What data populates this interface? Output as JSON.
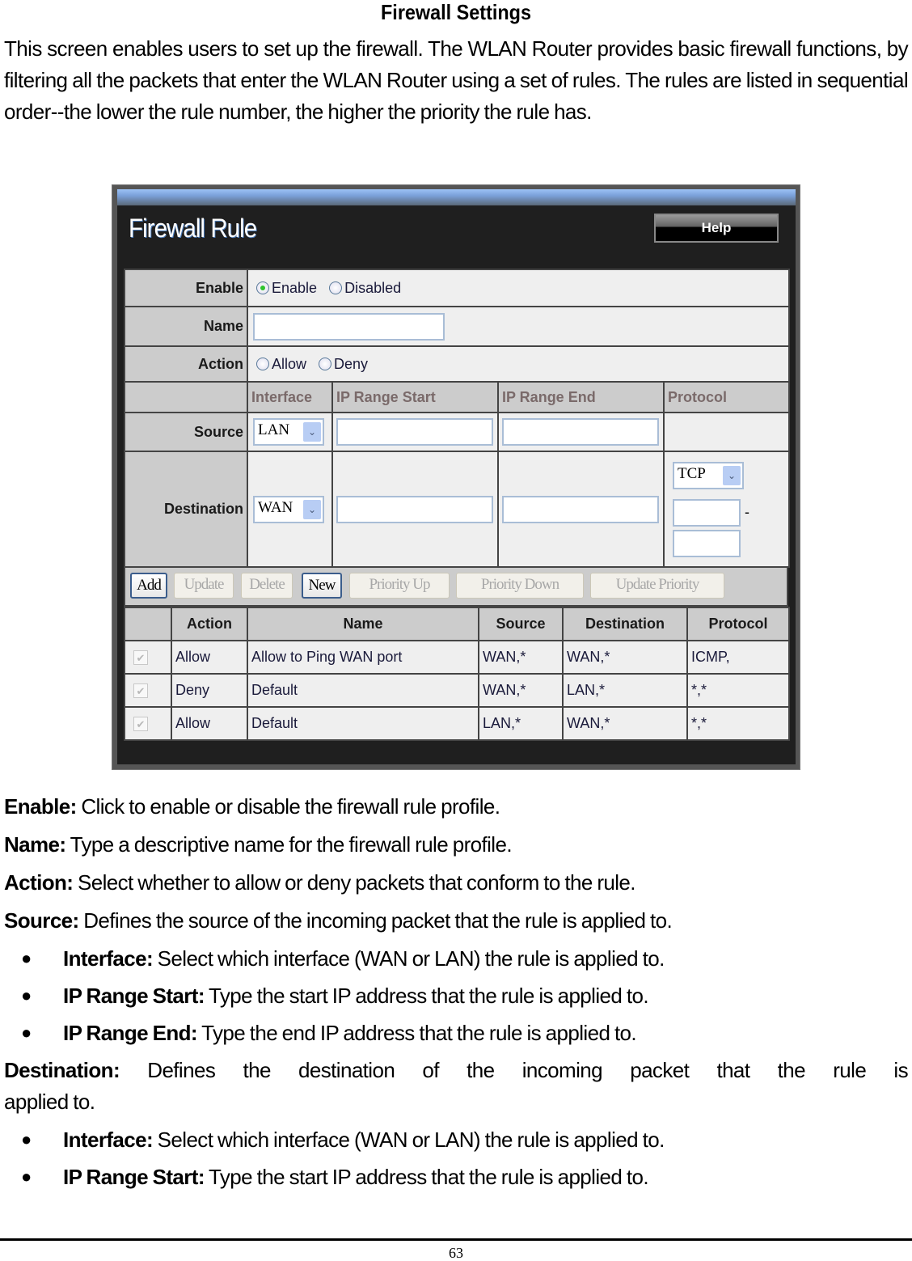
{
  "document": {
    "title": "Firewall Settings",
    "intro": "This screen enables users to set up the firewall. The WLAN Router provides basic firewall functions, by filtering all the packets that enter the WLAN Router using a set of rules. The rules are listed in sequential order--the lower the rule number, the higher the priority the rule has.",
    "descriptions": [
      {
        "term": "Enable:",
        "text": " Click to enable or disable the firewall rule profile."
      },
      {
        "term": "Name:",
        "text": " Type a descriptive name for the firewall rule profile."
      },
      {
        "term": "Action:",
        "text": " Select whether to allow or deny packets that conform to the rule."
      },
      {
        "term": "Source:",
        "text": " Defines the source of the incoming packet that the rule is applied to."
      }
    ],
    "source_bullets": [
      {
        "term": "Interface:",
        "text": " Select which interface (WAN or LAN) the rule is applied to."
      },
      {
        "term": "IP Range Start:",
        "text": " Type the start IP address that the rule is applied to."
      },
      {
        "term": "IP Range End:",
        "text": " Type the end IP address that the rule is applied to."
      }
    ],
    "destination": {
      "term": "Destination:",
      "text_line1": " Defines the destination of the incoming packet that the rule is",
      "text_line2": "applied to."
    },
    "destination_bullets": [
      {
        "term": "Interface:",
        "text": " Select which interface (WAN or LAN) the rule is applied to."
      },
      {
        "term": "IP Range Start:",
        "text": " Type the start IP address that the rule is applied to."
      }
    ],
    "bullet_glyph": "●",
    "page_number": "63"
  },
  "panel": {
    "title": "Firewall Rule",
    "help_label": "Help",
    "form": {
      "enable_label": "Enable",
      "enable_options": [
        "Enable",
        "Disabled"
      ],
      "enable_selected": "Enable",
      "name_label": "Name",
      "name_value": "",
      "action_label": "Action",
      "action_options": [
        "Allow",
        "Deny"
      ],
      "action_selected": "",
      "subheaders": [
        "Interface",
        "IP Range Start",
        "IP Range End",
        "Protocol"
      ],
      "source_label": "Source",
      "source_interface": "LAN",
      "source_ip_start": "",
      "source_ip_end": "",
      "destination_label": "Destination",
      "destination_interface": "WAN",
      "destination_ip_start": "",
      "destination_ip_end": "",
      "protocol": "TCP",
      "port_start": "",
      "port_end": "",
      "port_separator": "-"
    },
    "buttons": [
      {
        "label": "Add",
        "enabled": true
      },
      {
        "label": "Update",
        "enabled": false
      },
      {
        "label": "Delete",
        "enabled": false
      },
      {
        "label": "New",
        "enabled": true
      },
      {
        "label": "Priority Up",
        "enabled": false
      },
      {
        "label": "Priority Down",
        "enabled": false
      },
      {
        "label": "Update Priority",
        "enabled": false
      }
    ],
    "rules_table": {
      "columns": [
        "",
        "Action",
        "Name",
        "Source",
        "Destination",
        "Protocol"
      ],
      "rows": [
        {
          "checked": true,
          "action": "Allow",
          "name": "Allow to Ping WAN port",
          "source": "WAN,*",
          "destination": "WAN,*",
          "protocol": "ICMP,"
        },
        {
          "checked": true,
          "action": "Deny",
          "name": "Default",
          "source": "WAN,*",
          "destination": "LAN,*",
          "protocol": "*,*"
        },
        {
          "checked": true,
          "action": "Allow",
          "name": "Default",
          "source": "LAN,*",
          "destination": "WAN,*",
          "protocol": "*,*"
        }
      ]
    },
    "icons": {
      "dropdown": "chevron-down",
      "checkbox_mark": "✔"
    }
  }
}
